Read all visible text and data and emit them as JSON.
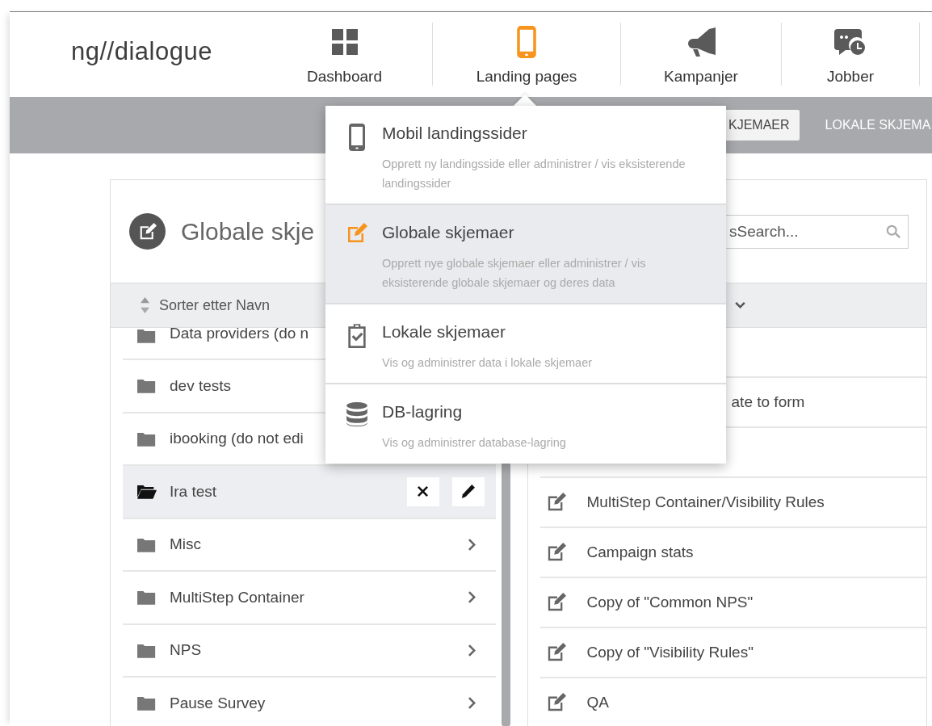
{
  "logo": {
    "text": "ng//dialogue"
  },
  "nav": [
    {
      "label": "Dashboard",
      "selected": false
    },
    {
      "label": "Landing pages",
      "selected": true
    },
    {
      "label": "Kampanjer",
      "selected": false
    },
    {
      "label": "Jobber",
      "selected": false
    }
  ],
  "subnav_tabs": [
    {
      "label": "KJEMAER",
      "selected": true
    },
    {
      "label": "LOKALE SKJEMA",
      "selected": false
    }
  ],
  "panel": {
    "title": "Globale skje",
    "search": {
      "placeholder": "sSearch..."
    },
    "sort_label": "Sorter etter Navn"
  },
  "folders": [
    {
      "name": "Data providers (do n",
      "selected": false
    },
    {
      "name": "dev tests",
      "selected": false
    },
    {
      "name": "ibooking (do not edi",
      "selected": false
    },
    {
      "name": "Ira test",
      "selected": true
    },
    {
      "name": "Misc",
      "selected": false,
      "chevron": true
    },
    {
      "name": "MultiStep Container",
      "selected": false,
      "chevron": true
    },
    {
      "name": "NPS",
      "selected": false,
      "chevron": true
    },
    {
      "name": "Pause Survey",
      "selected": false,
      "chevron": true
    }
  ],
  "forms": [
    {
      "kind": "covered"
    },
    {
      "kind": "partial",
      "name": "ate to form"
    },
    {
      "kind": "covered"
    },
    {
      "kind": "form",
      "name": "MultiStep Container/Visibility Rules"
    },
    {
      "kind": "form",
      "name": "Campaign stats"
    },
    {
      "kind": "form",
      "name": "Copy of \"Common NPS\""
    },
    {
      "kind": "form",
      "name": "Copy of \"Visibility Rules\""
    },
    {
      "kind": "form",
      "name": "QA"
    }
  ],
  "dropdown": {
    "items": [
      {
        "title": "Mobil landingssider",
        "description": "Opprett ny landingsside eller administrer / vis eksisterende landingssider",
        "selected": false
      },
      {
        "title": "Globale skjemaer",
        "description": "Opprett nye globale skjemaer eller administrer / vis eksisterende globale skjemaer og deres data",
        "selected": true
      },
      {
        "title": "Lokale skjemaer",
        "description": "Vis og administrer data i lokale skjemaer",
        "selected": false
      },
      {
        "title": "DB-lagring",
        "description": "Vis og administrer database-lagring",
        "selected": false
      }
    ]
  }
}
